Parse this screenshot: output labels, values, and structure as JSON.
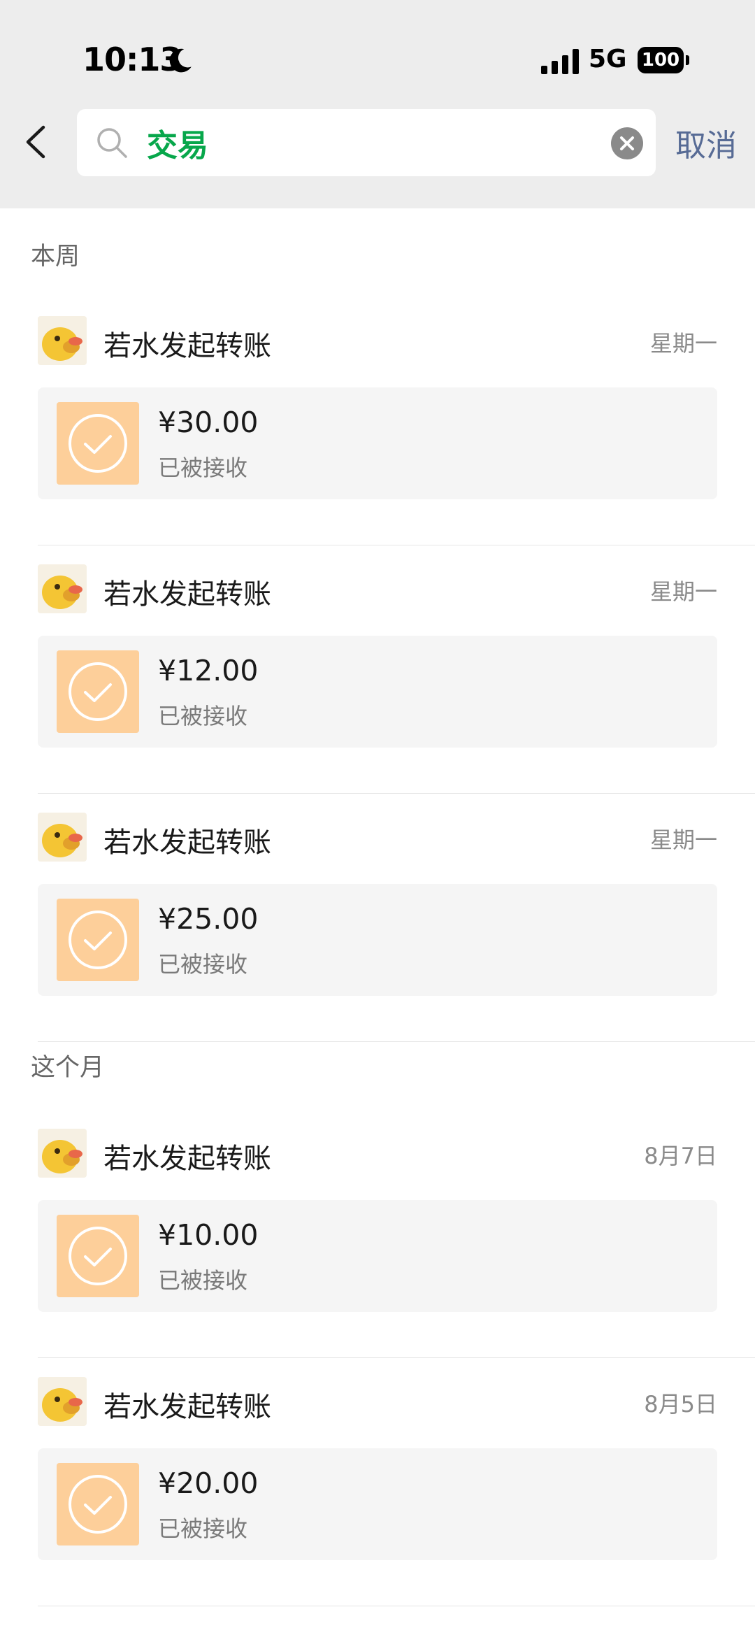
{
  "status_bar": {
    "time": "10:13",
    "network": "5G",
    "battery": "100"
  },
  "search": {
    "value": "交易",
    "cancel_label": "取消"
  },
  "sections": [
    {
      "title": "本周",
      "items": [
        {
          "title": "若水发起转账",
          "date": "星期一",
          "amount": "¥30.00",
          "status": "已被接收"
        },
        {
          "title": "若水发起转账",
          "date": "星期一",
          "amount": "¥12.00",
          "status": "已被接收"
        },
        {
          "title": "若水发起转账",
          "date": "星期一",
          "amount": "¥25.00",
          "status": "已被接收"
        }
      ]
    },
    {
      "title": "这个月",
      "items": [
        {
          "title": "若水发起转账",
          "date": "8月7日",
          "amount": "¥10.00",
          "status": "已被接收"
        },
        {
          "title": "若水发起转账",
          "date": "8月5日",
          "amount": "¥20.00",
          "status": "已被接收"
        }
      ]
    }
  ],
  "colors": {
    "accent_link": "#576b95",
    "search_text": "#07a74b",
    "transfer_icon_bg": "#fdcf9a"
  },
  "icons": {
    "back": "chevron-left-icon",
    "search": "search-icon",
    "clear": "clear-icon",
    "transfer": "check-circle-icon",
    "avatar": "duck-avatar"
  }
}
